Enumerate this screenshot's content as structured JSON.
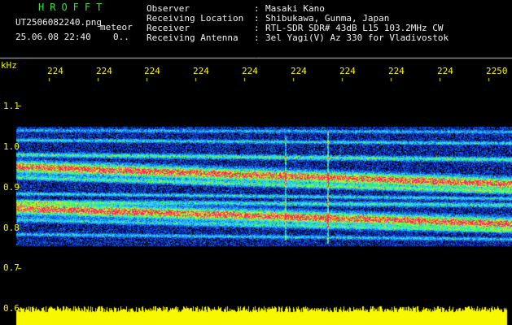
{
  "app": {
    "name": "HROFFT",
    "filename": "UT2506082240.png",
    "mode": "meteor",
    "datetime": "25.06.08 22:40",
    "counter": "0..",
    "name_color": "#44dd44"
  },
  "info": [
    {
      "label": "Observer",
      "value": "Masaki Kano"
    },
    {
      "label": "Receiving Location",
      "value": "Shibukawa, Gunma, Japan"
    },
    {
      "label": "Receiver",
      "value": "RTL-SDR SDR# 43dB L15 103.2MHz CW"
    },
    {
      "label": "Receiving Antenna",
      "value": "3el Yagi(V) Az 330 for Vladivostok"
    }
  ],
  "time_axis": {
    "labels": [
      "224",
      "224",
      "224",
      "224",
      "224",
      "224",
      "224",
      "224",
      "224",
      "2250"
    ]
  },
  "freq_axis": {
    "unit": "kHz",
    "labels": [
      "1.1",
      "1.0",
      "0.9",
      "0.8",
      "0.7",
      "0.6"
    ]
  },
  "colors": {
    "label_color": "#f4f400",
    "info_color": "#f0f0f0",
    "background": "#000000",
    "noise_floor": "#0a1a9a",
    "signal_strong": "#ff2050",
    "signal_mid": "#40ff60",
    "signal_weak": "#30d0ff",
    "level_bar": "#f8f800"
  }
}
